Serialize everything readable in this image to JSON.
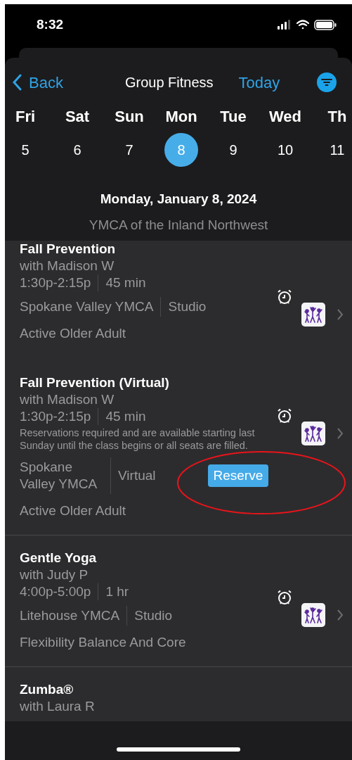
{
  "status_bar": {
    "time": "8:32"
  },
  "nav": {
    "back": "Back",
    "title": "Group Fitness",
    "today": "Today"
  },
  "days": [
    {
      "name": "Fri",
      "date": "5",
      "selected": false
    },
    {
      "name": "Sat",
      "date": "6",
      "selected": false
    },
    {
      "name": "Sun",
      "date": "7",
      "selected": false
    },
    {
      "name": "Mon",
      "date": "8",
      "selected": true
    },
    {
      "name": "Tue",
      "date": "9",
      "selected": false
    },
    {
      "name": "Wed",
      "date": "10",
      "selected": false
    },
    {
      "name": "Th",
      "date": "11",
      "selected": false
    }
  ],
  "date_heading": "Monday, January 8, 2024",
  "organization": "YMCA of the Inland Northwest",
  "classes": [
    {
      "title": "Fall Prevention",
      "instructor": "with Madison W",
      "time": "1:30p-2:15p",
      "duration": "45 min",
      "location": "Spokane Valley YMCA",
      "room": "Studio",
      "category": "Active Older Adult"
    },
    {
      "title": "Fall Prevention (Virtual)",
      "instructor": "with Madison W",
      "time": "1:30p-2:15p",
      "duration": "45 min",
      "note": "Reservations required and are available starting last Sunday until the class begins or all seats are filled.",
      "location": "Spokane Valley YMCA",
      "room": "Virtual",
      "reserve": "Reserve",
      "category": "Active Older Adult",
      "annotated": true
    },
    {
      "title": "Gentle Yoga",
      "instructor": "with Judy P",
      "time": "4:00p-5:00p",
      "duration": "1 hr",
      "location": "Litehouse YMCA",
      "room": "Studio",
      "category": "Flexibility Balance And Core"
    },
    {
      "title": "Zumba®",
      "instructor": "with Laura R"
    }
  ]
}
